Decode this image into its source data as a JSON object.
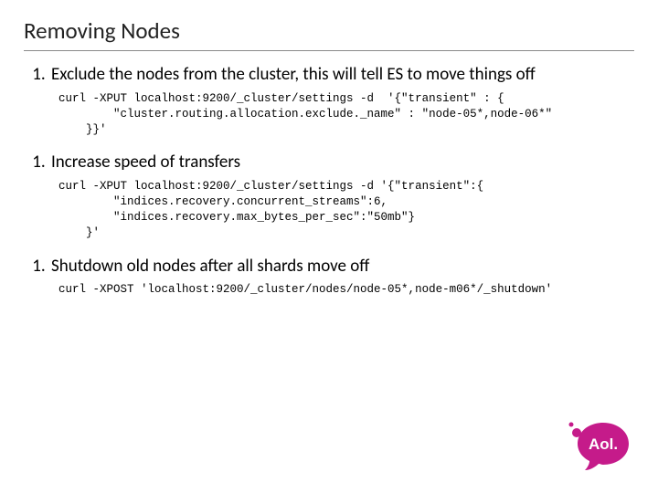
{
  "title": "Removing Nodes",
  "items": [
    {
      "text": "Exclude the nodes from the cluster, this will tell ES to move things off",
      "code": "curl -XPUT localhost:9200/_cluster/settings -d  '{\"transient\" : {\n        \"cluster.routing.allocation.exclude._name\" : \"node-05*,node-06*\"\n    }}'"
    },
    {
      "text": "Increase speed of transfers",
      "code": "curl -XPUT localhost:9200/_cluster/settings -d '{\"transient\":{\n        \"indices.recovery.concurrent_streams\":6,\n        \"indices.recovery.max_bytes_per_sec\":\"50mb\"}\n    }'"
    },
    {
      "text": "Shutdown old nodes after all shards move off",
      "code": "curl -XPOST 'localhost:9200/_cluster/nodes/node-05*,node-m06*/_shutdown'"
    }
  ],
  "logo_text": "Aol."
}
